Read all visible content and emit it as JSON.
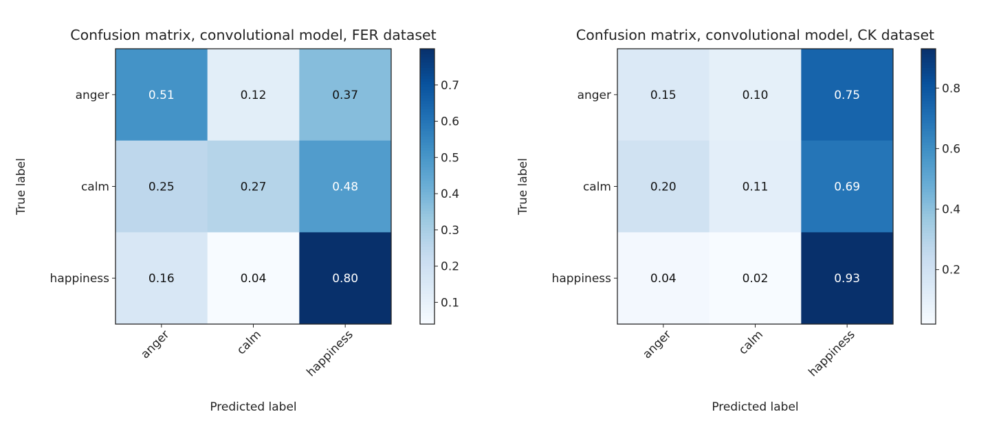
{
  "chart_data": [
    {
      "type": "heatmap",
      "title": "Confusion matrix, convolutional model, FER dataset",
      "xlabel": "Predicted label",
      "ylabel": "True label",
      "x_categories": [
        "anger",
        "calm",
        "happiness"
      ],
      "y_categories": [
        "anger",
        "calm",
        "happiness"
      ],
      "values": [
        [
          0.51,
          0.12,
          0.37
        ],
        [
          0.25,
          0.27,
          0.48
        ],
        [
          0.16,
          0.04,
          0.8
        ]
      ],
      "cell_labels": [
        [
          "0.51",
          "0.12",
          "0.37"
        ],
        [
          "0.25",
          "0.27",
          "0.48"
        ],
        [
          "0.16",
          "0.04",
          "0.80"
        ]
      ],
      "colormap": "Blues",
      "colorbar": {
        "range": [
          0.04,
          0.8
        ],
        "ticks": [
          0.1,
          0.2,
          0.3,
          0.4,
          0.5,
          0.6,
          0.7
        ],
        "tick_labels": [
          "0.1",
          "0.2",
          "0.3",
          "0.4",
          "0.5",
          "0.6",
          "0.7"
        ]
      }
    },
    {
      "type": "heatmap",
      "title": "Confusion matrix, convolutional model, CK dataset",
      "xlabel": "Predicted label",
      "ylabel": "True label",
      "x_categories": [
        "anger",
        "calm",
        "happiness"
      ],
      "y_categories": [
        "anger",
        "calm",
        "happiness"
      ],
      "values": [
        [
          0.15,
          0.1,
          0.75
        ],
        [
          0.2,
          0.11,
          0.69
        ],
        [
          0.04,
          0.02,
          0.93
        ]
      ],
      "cell_labels": [
        [
          "0.15",
          "0.10",
          "0.75"
        ],
        [
          "0.20",
          "0.11",
          "0.69"
        ],
        [
          "0.04",
          "0.02",
          "0.93"
        ]
      ],
      "colormap": "Blues",
      "colorbar": {
        "range": [
          0.02,
          0.93
        ],
        "ticks": [
          0.2,
          0.4,
          0.6,
          0.8
        ],
        "tick_labels": [
          "0.2",
          "0.4",
          "0.6",
          "0.8"
        ]
      }
    }
  ]
}
